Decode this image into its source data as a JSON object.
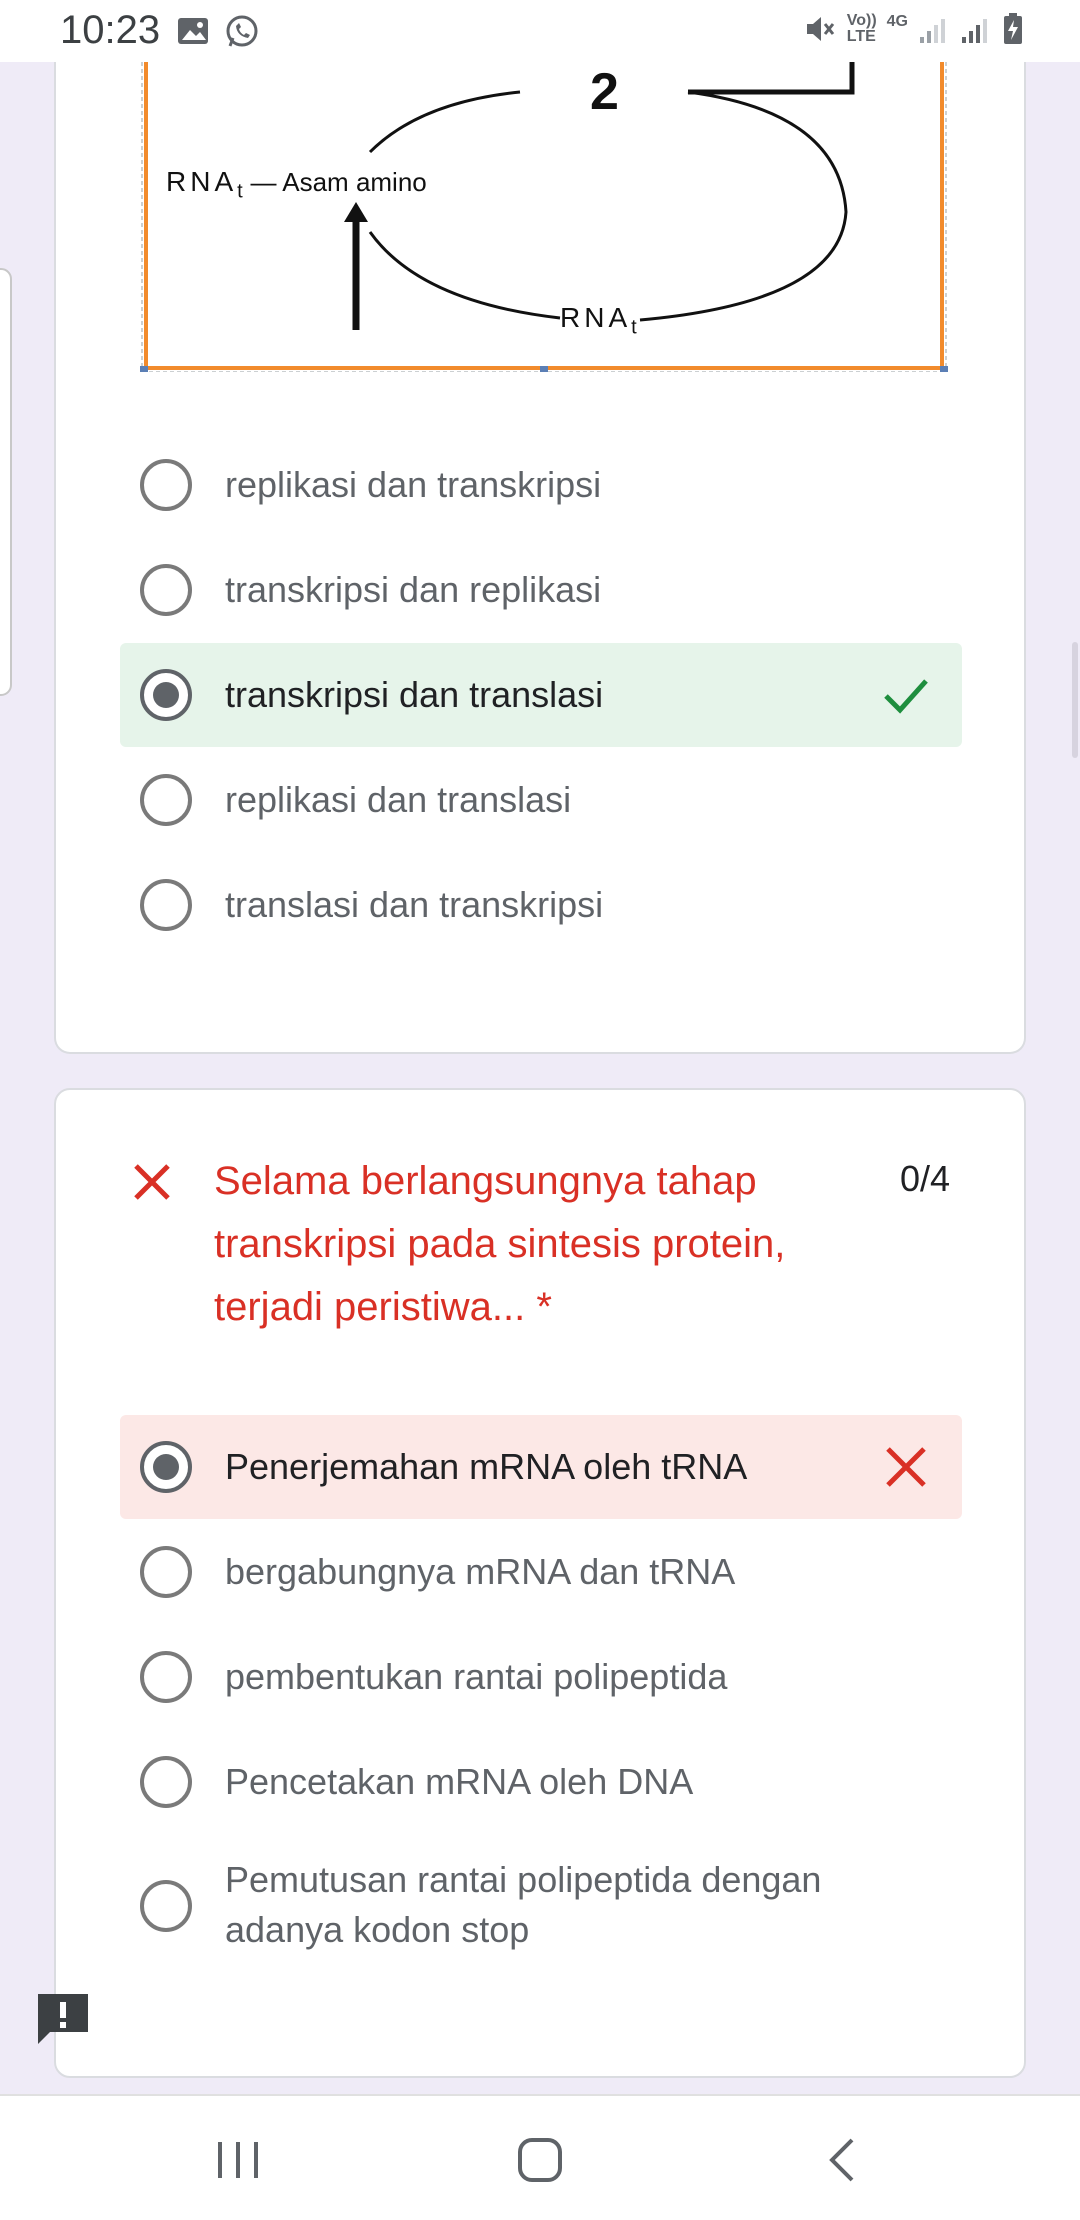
{
  "status_bar": {
    "time": "10:23",
    "icons_left": [
      "image-icon",
      "whatsapp-icon"
    ],
    "network_label_top": "Vo))",
    "network_label_bottom": "LTE",
    "network_4g": "4G",
    "icons_right": [
      "mute-icon",
      "signal-icon",
      "signal-icon",
      "battery-icon"
    ]
  },
  "diagram": {
    "number_label": "2",
    "left_label": "RNA",
    "left_label_sub": "t",
    "left_label_suffix": "— Asam amino",
    "bottom_label": "RNA",
    "bottom_label_sub": "t"
  },
  "question1": {
    "options": [
      {
        "label": "replikasi dan transkripsi",
        "selected": false
      },
      {
        "label": "transkripsi dan replikasi",
        "selected": false
      },
      {
        "label": "transkripsi dan translasi",
        "selected": true,
        "result": "correct"
      },
      {
        "label": "replikasi dan translasi",
        "selected": false
      },
      {
        "label": "translasi dan transkripsi",
        "selected": false
      }
    ]
  },
  "question2": {
    "title": "Selama berlangsungnya tahap transkripsi pada sintesis protein, terjadi peristiwa... *",
    "score": "0/4",
    "options": [
      {
        "label": "Penerjemahan mRNA oleh tRNA",
        "selected": true,
        "result": "wrong"
      },
      {
        "label": "bergabungnya mRNA dan tRNA",
        "selected": false
      },
      {
        "label": "pembentukan rantai polipeptida",
        "selected": false
      },
      {
        "label": "Pencetakan mRNA oleh DNA",
        "selected": false
      },
      {
        "label": "Pemutusan rantai polipeptida dengan adanya kodon stop",
        "selected": false
      }
    ]
  },
  "colors": {
    "correct_bg": "#e6f4ea",
    "correct_check": "#1e8e3e",
    "wrong_bg": "#fce8e6",
    "wrong_x": "#d93025",
    "page_bg": "#efebf7",
    "diagram_border": "#f28b2c"
  },
  "nav": {
    "icons": [
      "recent-apps-icon",
      "home-icon",
      "back-icon"
    ]
  }
}
